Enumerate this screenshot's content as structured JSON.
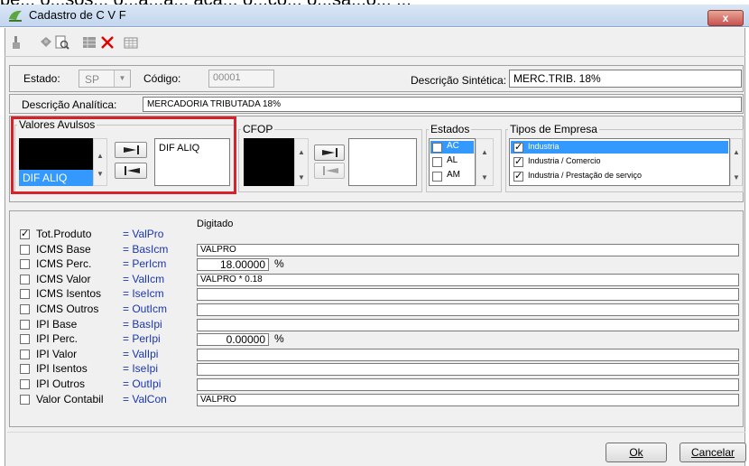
{
  "background_caption": "pé... o...sos... o...a...a... aça... o...ço... o...sa...o... ...",
  "window": {
    "title": "Cadastro de C V F",
    "close_label": "x"
  },
  "toolbar": {
    "icons": [
      "hand-pointer-icon",
      "puzzle-icon",
      "preview-icon",
      "grid-icon",
      "delete-icon",
      "table-icon"
    ],
    "delete_color": "#e00000"
  },
  "header": {
    "estado_label": "Estado:",
    "estado_value": "SP",
    "codigo_label": "Código:",
    "codigo_value": "00001",
    "desc_sintetica_label": "Descrição Sintética:",
    "desc_sintetica_value": "MERC.TRIB. 18%",
    "desc_analitica_label": "Descrição Analítica:",
    "desc_analitica_value": "MERCADORIA TRIBUTADA 18%"
  },
  "valores_avulsos": {
    "legend": "Valores Avulsos",
    "selected_item": "DIF ALIQ",
    "right_list": [
      "DIF ALIQ"
    ],
    "highlight_color": "#d6232a"
  },
  "cfop": {
    "legend": "CFOP"
  },
  "estados": {
    "legend": "Estados",
    "items": [
      {
        "label": "AC",
        "checked": false,
        "selected": true
      },
      {
        "label": "AL",
        "checked": false,
        "selected": false
      },
      {
        "label": "AM",
        "checked": false,
        "selected": false
      }
    ]
  },
  "tipos_empresa": {
    "legend": "Tipos de Empresa",
    "items": [
      {
        "label": "Industria",
        "checked": true,
        "selected": true
      },
      {
        "label": "Industria / Comercio",
        "checked": true,
        "selected": false
      },
      {
        "label": "Industria / Prestação de serviço",
        "checked": true,
        "selected": false
      }
    ]
  },
  "grid": {
    "header_digitado": "Digitado",
    "rows": [
      {
        "label": "Tot.Produto",
        "var": "= ValPro",
        "checked": true,
        "value": "",
        "kind": "none"
      },
      {
        "label": "ICMS Base",
        "var": "= BasIcm",
        "checked": false,
        "value": "VALPRO",
        "kind": "text"
      },
      {
        "label": "ICMS Perc.",
        "var": "= PerIcm",
        "checked": false,
        "value": "18.00000",
        "kind": "pct"
      },
      {
        "label": "ICMS Valor",
        "var": "= ValIcm",
        "checked": false,
        "value": "VALPRO * 0.18",
        "kind": "text"
      },
      {
        "label": "ICMS Isentos",
        "var": "= IseIcm",
        "checked": false,
        "value": "",
        "kind": "text"
      },
      {
        "label": "ICMS Outros",
        "var": "= OutIcm",
        "checked": false,
        "value": "",
        "kind": "text"
      },
      {
        "label": "IPI Base",
        "var": "= BasIpi",
        "checked": false,
        "value": "",
        "kind": "text"
      },
      {
        "label": "IPI Perc.",
        "var": "= PerIpi",
        "checked": false,
        "value": "0.00000",
        "kind": "pct"
      },
      {
        "label": "IPI Valor",
        "var": "= ValIpi",
        "checked": false,
        "value": "",
        "kind": "text"
      },
      {
        "label": "IPI Isentos",
        "var": "= IseIpi",
        "checked": false,
        "value": "",
        "kind": "text"
      },
      {
        "label": "IPI Outros",
        "var": "= OutIpi",
        "checked": false,
        "value": "",
        "kind": "text"
      },
      {
        "label": "Valor Contabil",
        "var": "= ValCon",
        "checked": false,
        "value": "VALPRO",
        "kind": "text"
      }
    ],
    "pct_symbol": "%"
  },
  "buttons": {
    "ok": "Ok",
    "cancelar": "Cancelar"
  }
}
